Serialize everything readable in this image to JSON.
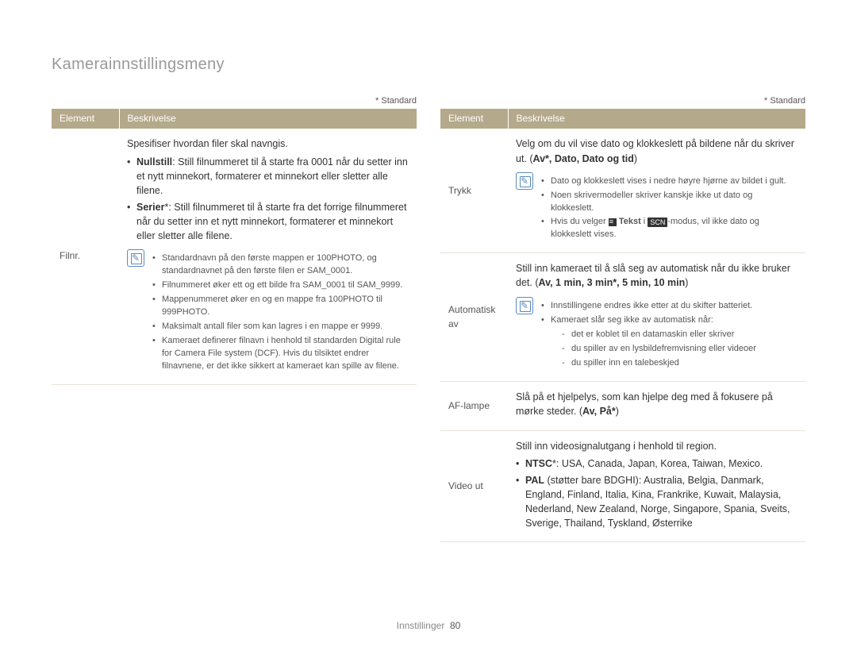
{
  "title": "Kamerainnstillingsmeny",
  "standard_note": "* Standard",
  "footer_label": "Innstillinger",
  "footer_page": "80",
  "left": {
    "th_element": "Element",
    "th_desc": "Beskrivelse",
    "row": {
      "label": "Filnr.",
      "intro": "Spesifiser hvordan filer skal navngis.",
      "b1_bold": "Nullstill",
      "b1_rest": ": Still filnummeret til å starte fra 0001 når du setter inn et nytt minnekort, formaterer et minnekort eller sletter alle filene.",
      "b2_bold": "Serier",
      "b2_rest": "*: Still filnummeret til å starte fra det forrige filnummeret når du setter inn et nytt minnekort, formaterer et minnekort eller sletter alle filene.",
      "notes": [
        "Standardnavn på den første mappen er 100PHOTO, og standardnavnet på den første filen er SAM_0001.",
        "Filnummeret øker ett og ett bilde fra SAM_0001 til SAM_9999.",
        "Mappenummeret øker en og en mappe fra 100PHOTO til 999PHOTO.",
        "Maksimalt antall filer som kan lagres i en mappe er 9999.",
        "Kameraet definerer filnavn i henhold til standarden Digital rule for Camera File system (DCF). Hvis du tilsiktet endrer filnavnene, er det ikke sikkert at kameraet kan spille av filene."
      ]
    }
  },
  "right": {
    "th_element": "Element",
    "th_desc": "Beskrivelse",
    "trykk": {
      "label": "Trykk",
      "line1": "Velg om du vil vise dato og klokkeslett på bildene når du skriver ut. (",
      "opts": "Av*, Dato, Dato og tid",
      "close": ")",
      "notes": [
        "Dato og klokkeslett vises i nedre høyre hjørne av bildet i gult.",
        "Noen skrivermodeller skriver kanskje ikke ut dato og klokkeslett."
      ],
      "note3_a": "Hvis du velger ",
      "note3_tekst": "Tekst",
      "note3_b": " i ",
      "note3_scn": "SCN",
      "note3_c": "-modus, vil ikke dato og klokkeslett vises."
    },
    "auto": {
      "label": "Automatisk av",
      "line1": "Still inn kameraet til å slå seg av automatisk når du ikke bruker det. (",
      "opts": "Av, 1 min, 3 min*, 5 min, 10 min",
      "close": ")",
      "note_a": "Innstillingene endres ikke etter at du skifter batteriet.",
      "note_b_intro": "Kameraet slår seg ikke av automatisk når:",
      "note_b_items": [
        "det er koblet til en datamaskin eller skriver",
        "du spiller av en lysbildefremvisning eller videoer",
        "du spiller inn en talebeskjed"
      ]
    },
    "af": {
      "label": "AF-lampe",
      "line1": "Slå på et hjelpelys, som kan hjelpe deg med å fokusere på mørke steder. (",
      "opts": "Av, På*",
      "close": ")"
    },
    "video": {
      "label": "Video ut",
      "line1": "Still inn videosignalutgang i henhold til region.",
      "b1_bold": "NTSC",
      "b1_rest": "*: USA, Canada, Japan, Korea, Taiwan, Mexico.",
      "b2_bold": "PAL",
      "b2_rest": " (støtter bare BDGHI): Australia, Belgia, Danmark, England, Finland, Italia, Kina, Frankrike, Kuwait, Malaysia, Nederland, New Zealand, Norge, Singapore, Spania, Sveits, Sverige, Thailand, Tyskland, Østerrike"
    }
  }
}
